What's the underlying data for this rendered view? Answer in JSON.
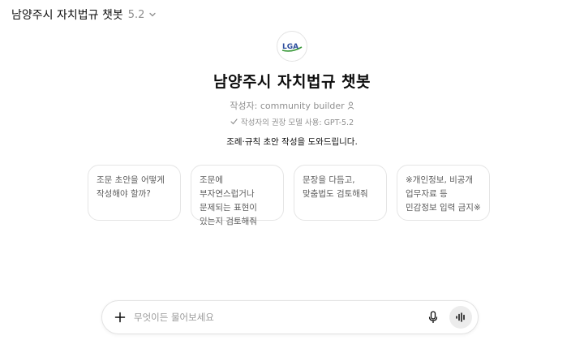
{
  "header": {
    "title": "남양주시 자치법규 챗봇",
    "version": "5.2"
  },
  "gpt": {
    "logo_text": "LGA",
    "name": "남양주시 자치법규 챗봇",
    "author": "작성자: community builder",
    "model_note": "작성자의 권장 모델 사용: GPT-5.2",
    "description": "조례·규칙 초안 작성을 도와드립니다."
  },
  "starters": [
    {
      "text": "조문 초안을 어떻게 작성해야 할까?"
    },
    {
      "text": "조문에 부자연스럽거나 문제되는 표현이 있는지 검토해줘"
    },
    {
      "text": "문장을 다듬고, 맞춤법도 검토해줘"
    },
    {
      "text": "※개인정보, 비공개 업무자료 등 민감정보 입력 금지※"
    }
  ],
  "composer": {
    "placeholder": "무엇이든 물어보세요",
    "value": ""
  },
  "icons": {
    "chevron": "chevron-down-icon",
    "person": "person-icon",
    "check": "check-icon",
    "plus": "plus-icon",
    "mic": "microphone-icon",
    "voice": "voice-waveform-icon"
  },
  "colors": {
    "logo_blue": "#2f4f9e",
    "logo_green": "#3c9a3c",
    "muted_text": "#8f8f8f",
    "card_border": "#e5e5e5"
  }
}
